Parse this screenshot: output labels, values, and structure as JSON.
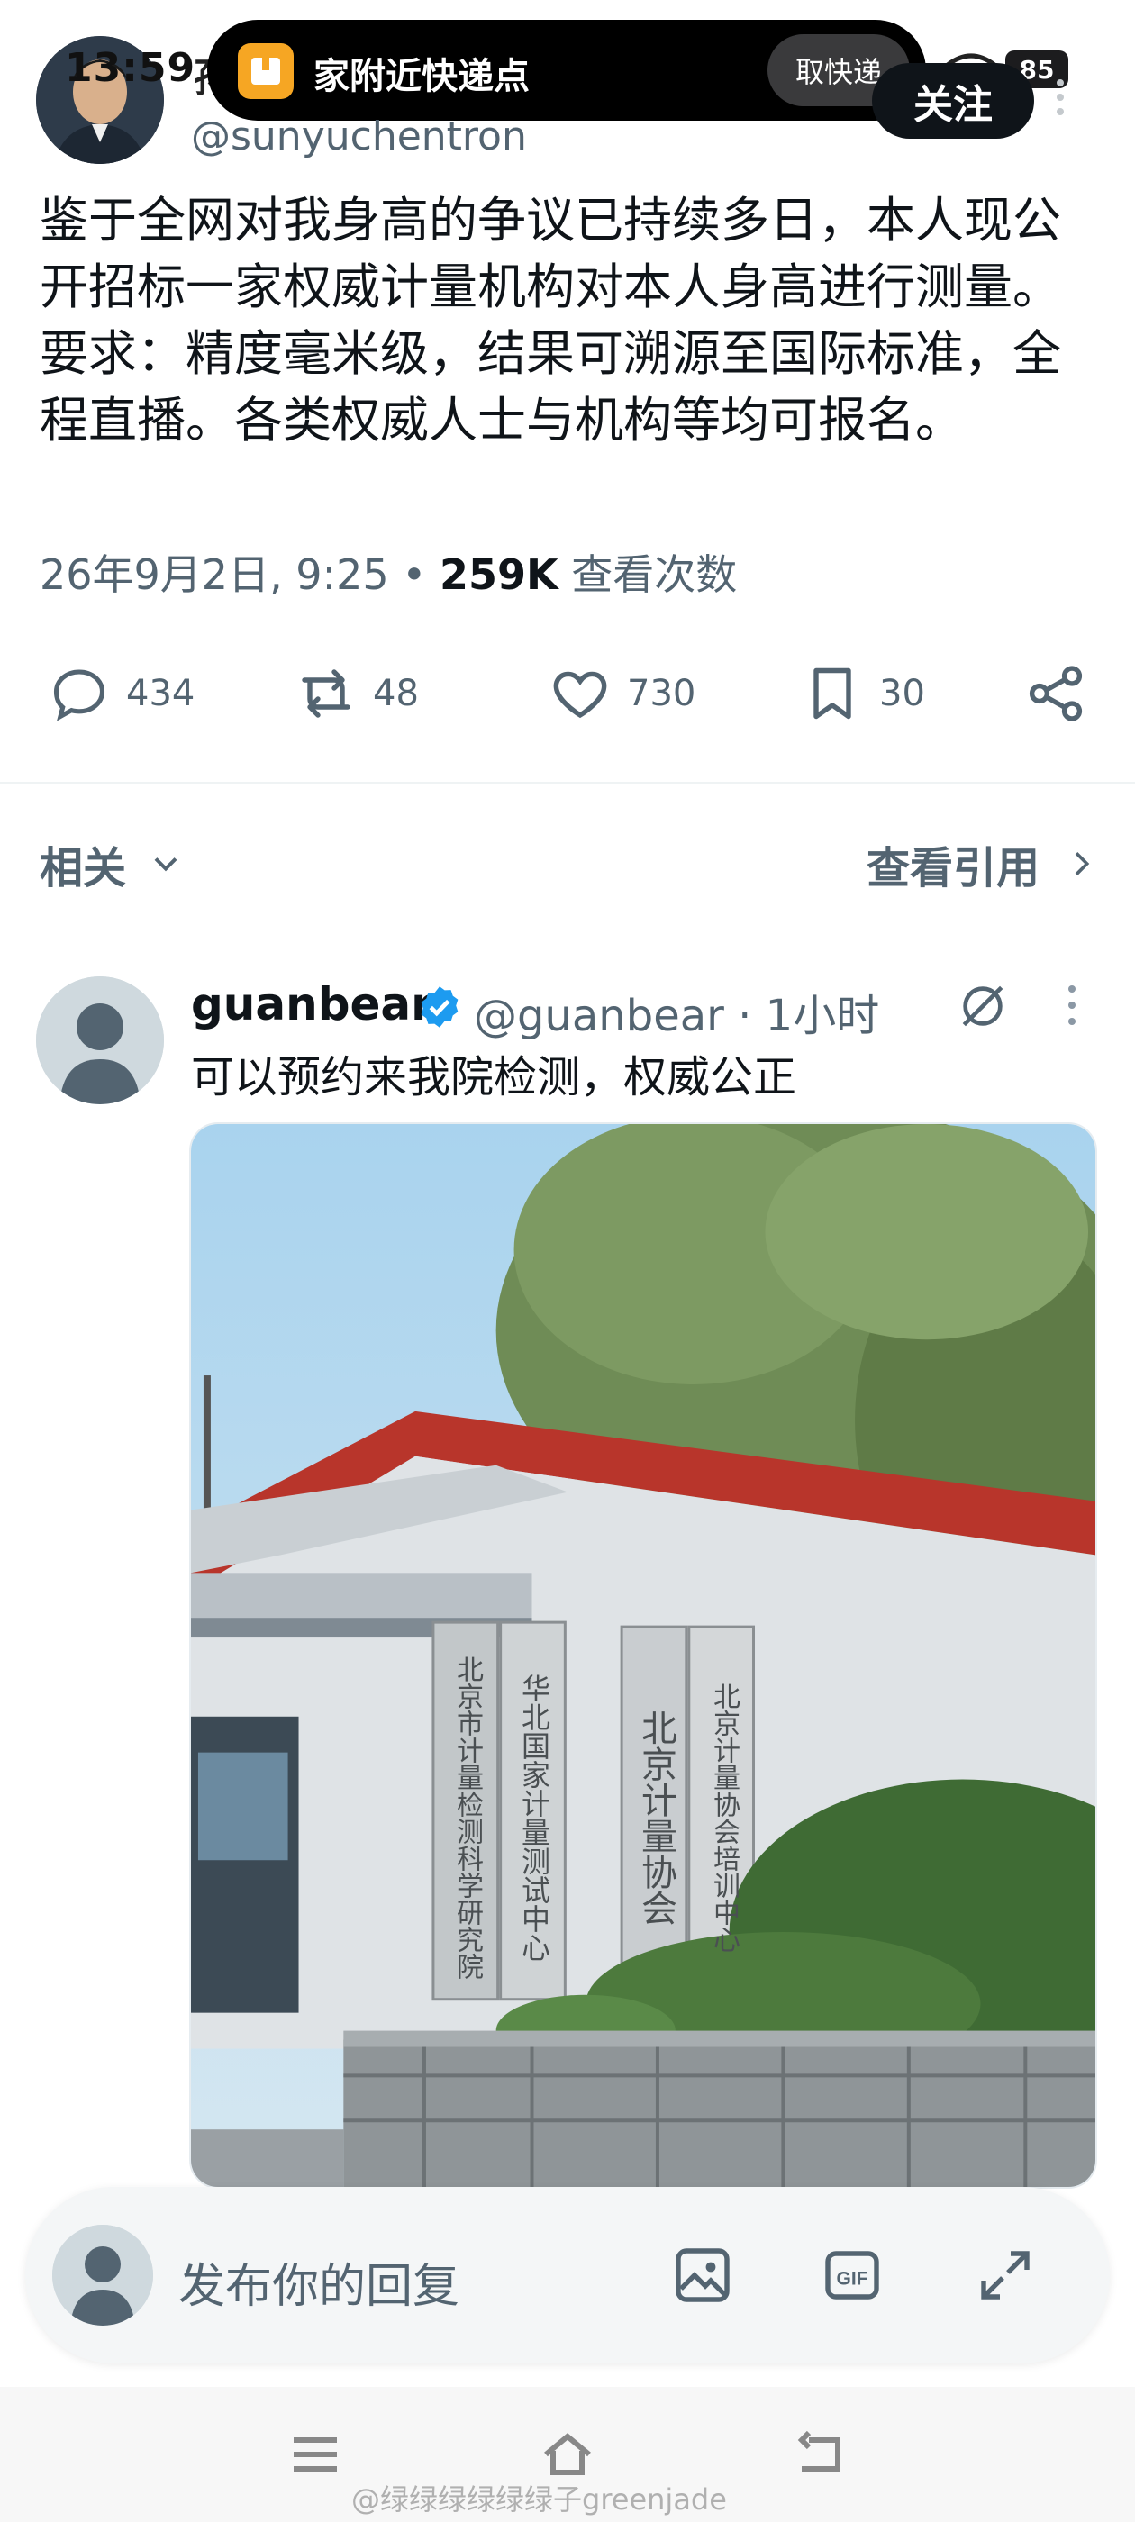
{
  "status": {
    "time": "13:59",
    "battery": "85",
    "name_partial": "孙"
  },
  "island": {
    "text": "家附近快递点",
    "action": "取快递"
  },
  "tweet": {
    "handle": "@sunyuchentron",
    "follow_label": "关注",
    "text": "鉴于全网对我身高的争议已持续多日，本人现公开招标一家权威计量机构对本人身高进行测量。要求：精度毫米级，结果可溯源至国际标准，全程直播。各类权威人士与机构等均可报名。",
    "date": "26年9月2日, 9:25 • ",
    "views": "259K",
    "views_label": " 查看次数",
    "stats": {
      "replies": "434",
      "reposts": "48",
      "likes": "730",
      "bookmarks": "30"
    }
  },
  "section": {
    "related": "相关",
    "quotes": "查看引用"
  },
  "reply": {
    "name": "guanbear",
    "handle_time": "@guanbear · 1小时",
    "text": "可以预约来我院检测，权威公正",
    "photo_signs": [
      "北京市计量检测科学研究院",
      "华北国家计量测试中心",
      "北京计量协会",
      "北京计量协会培训中心"
    ]
  },
  "composer": {
    "placeholder": "发布你的回复"
  },
  "watermark": "@绿绿绿绿绿绿子greenjade",
  "colors": {
    "accent": "#1d9bf0",
    "text": "#0f1419",
    "secondary": "#536471"
  }
}
